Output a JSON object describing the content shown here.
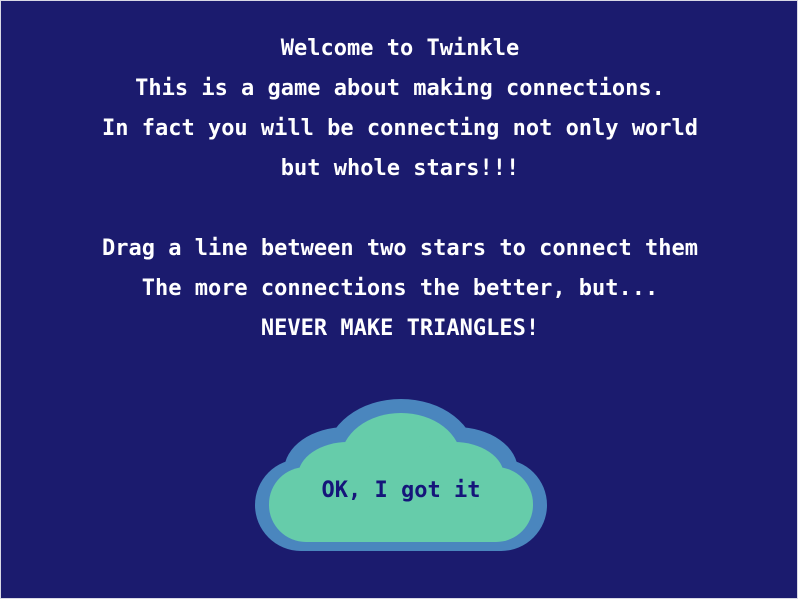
{
  "intro": {
    "lines": [
      "Welcome to Twinkle",
      "This is a game about making connections.",
      "In fact you will be connecting not only world",
      "but whole stars!!!",
      "",
      "Drag a line between two stars to connect them",
      "The more connections the better, but...",
      "NEVER MAKE TRIANGLES!"
    ]
  },
  "ok_button": {
    "label": "OK, I got it",
    "shape_icon": "cloud-icon"
  },
  "colors": {
    "background": "#1b1b6e",
    "text": "#ffffff",
    "cloud_fill": "#66ccaa",
    "cloud_outline": "#4a86be",
    "button_text": "#15157a"
  }
}
